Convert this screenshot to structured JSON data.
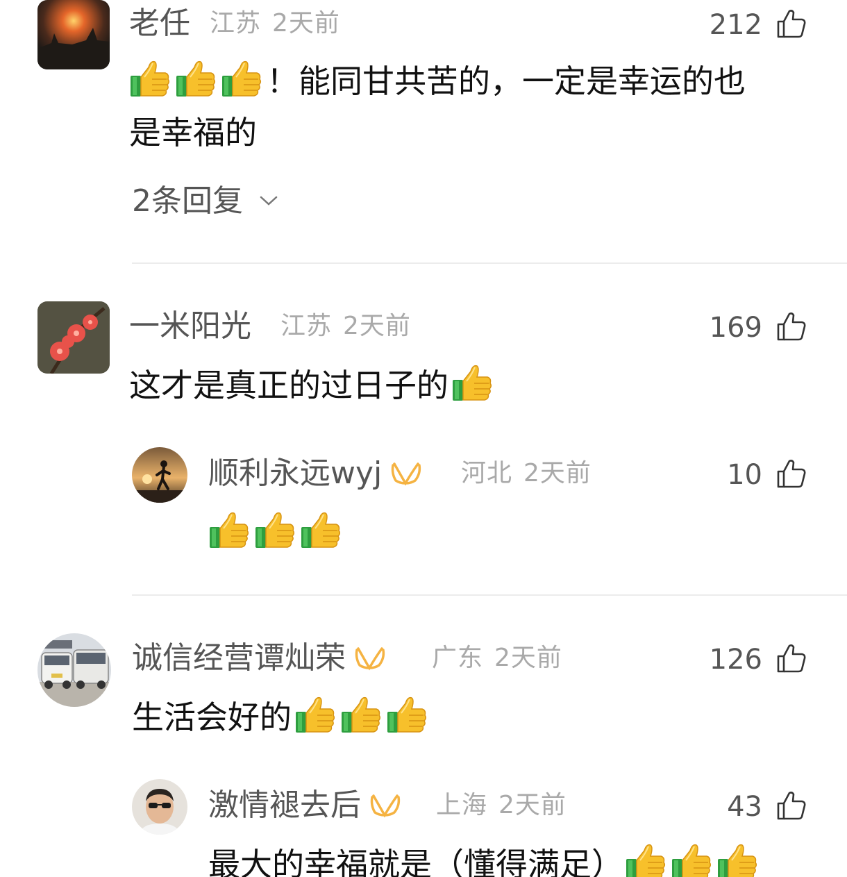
{
  "comments": [
    {
      "user": "老任",
      "region": "江苏",
      "date": "2天前",
      "likes": "212",
      "text_prefix": "！能同甘共苦的，一定是幸运的也",
      "text_line2": "是幸福的",
      "replies_link": "2条回复"
    },
    {
      "user": "一米阳光",
      "region": "江苏",
      "date": "2天前",
      "likes": "169",
      "text": "这才是真正的过日子的",
      "reply": {
        "user": "顺利永远wyj",
        "region": "河北",
        "date": "2天前",
        "likes": "10"
      }
    },
    {
      "user": "诚信经营谭灿荣",
      "region": "广东",
      "date": "2天前",
      "likes": "126",
      "text": "生活会好的",
      "reply": {
        "user": "激情褪去后",
        "region": "上海",
        "date": "2天前",
        "likes": "43",
        "text": "最大的幸福就是（懂得满足）"
      }
    }
  ],
  "icons": {
    "like": "thumbs-up-outline-icon",
    "emoji": "thumbs-up-emoji",
    "vip": "vip-badge-icon",
    "expand": "chevron-down-icon"
  },
  "colors": {
    "vip_badge": "#f5b342",
    "meta_text": "#a9a9a9",
    "name_text": "#555555"
  }
}
